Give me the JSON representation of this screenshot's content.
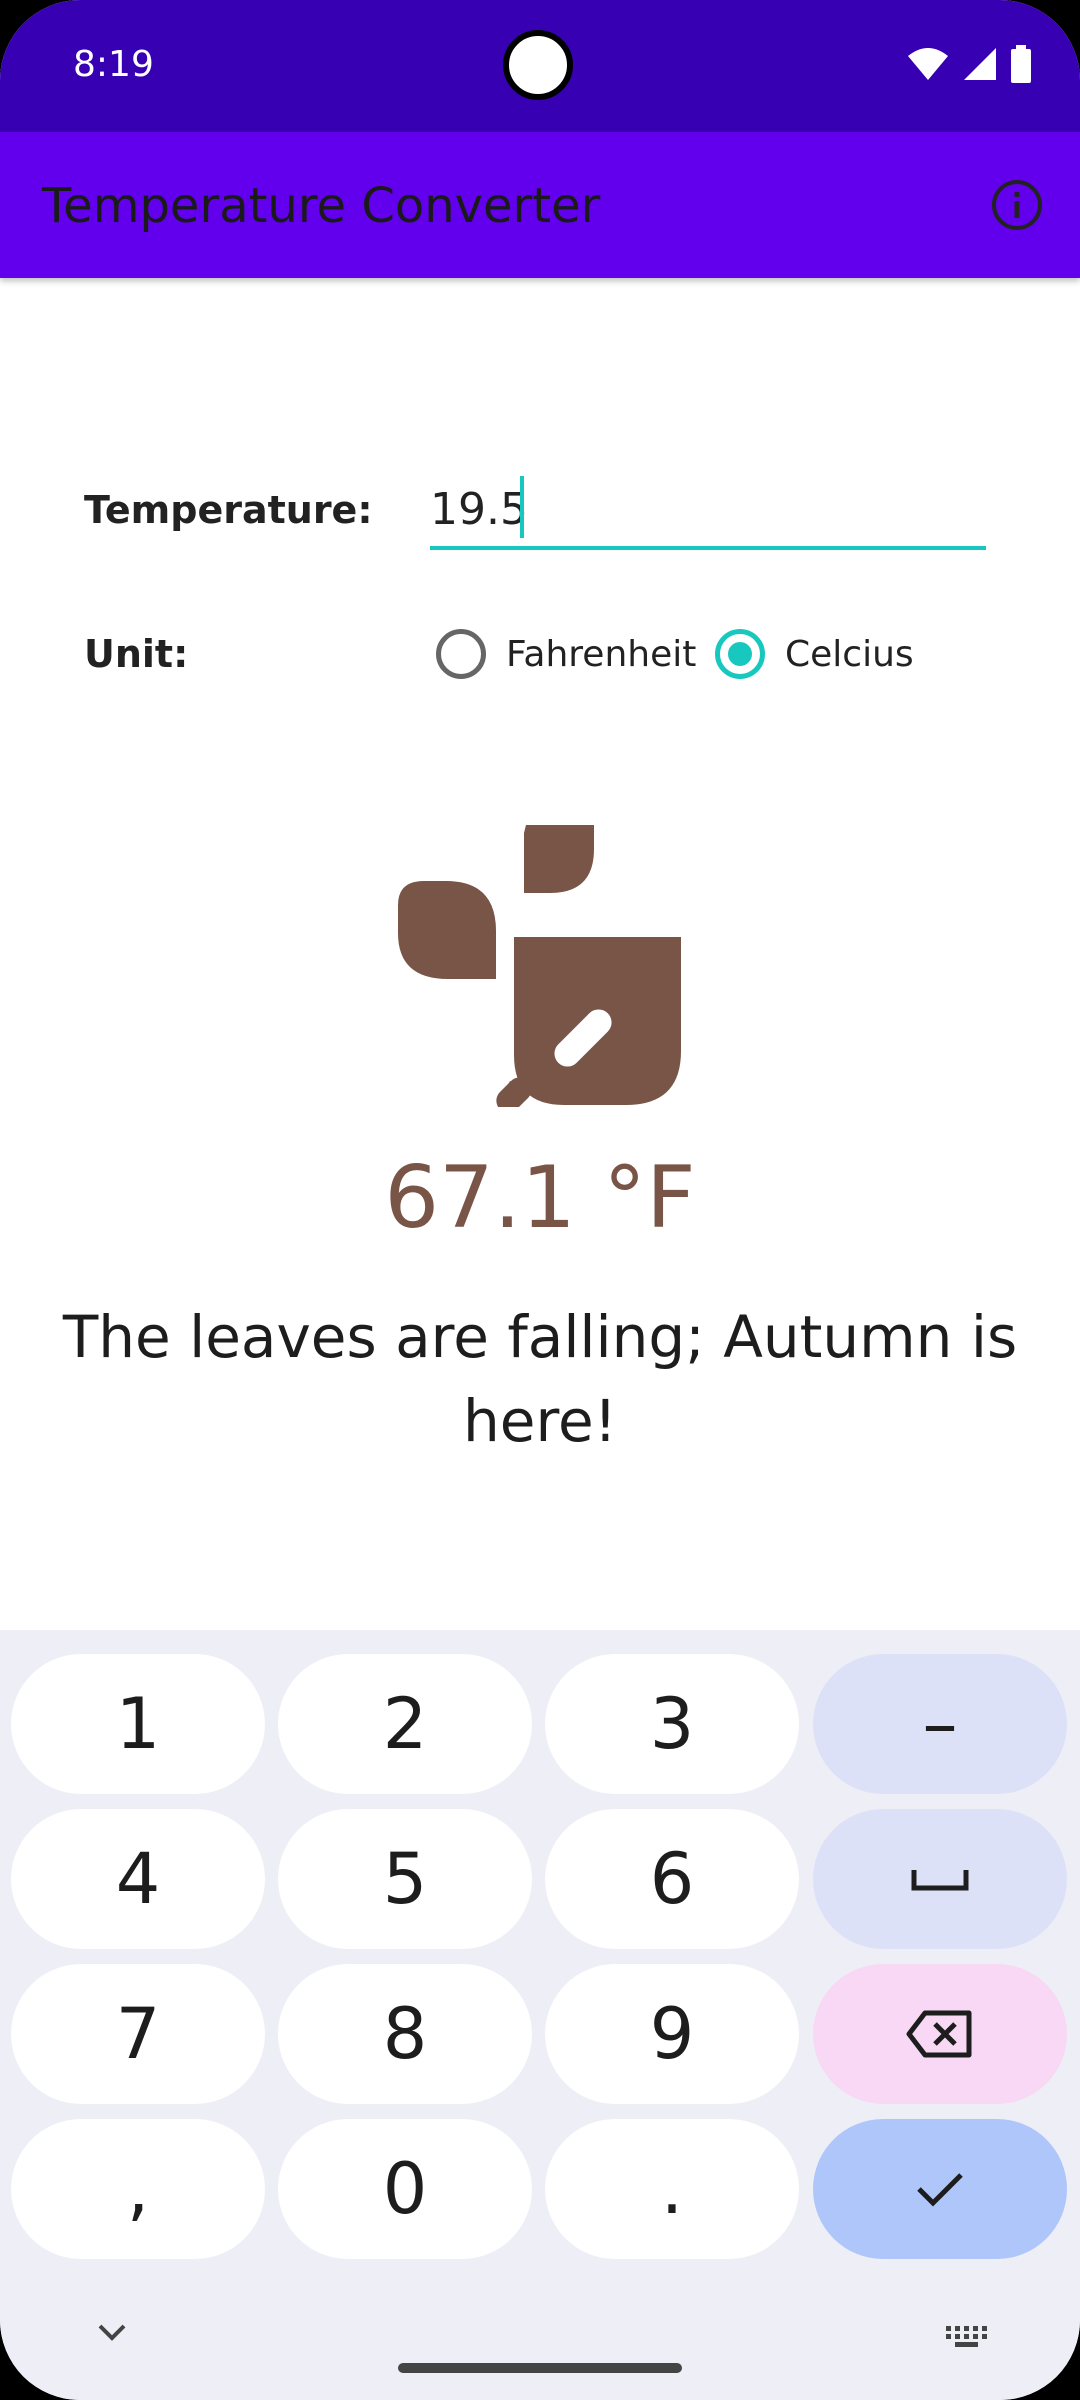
{
  "status_bar": {
    "time": "8:19",
    "icons": [
      "wifi-icon",
      "signal-icon",
      "battery-icon"
    ]
  },
  "app_bar": {
    "title": "Temperature Converter",
    "action_icon": "info-icon"
  },
  "form": {
    "temperature_label": "Temperature:",
    "temperature_value": "19.5",
    "unit_label": "Unit:",
    "units": [
      {
        "label": "Fahrenheit",
        "selected": false
      },
      {
        "label": "Celcius",
        "selected": true
      }
    ]
  },
  "result": {
    "icon": "leaves-icon",
    "value": "67.1 °F",
    "message": "The leaves are falling; Autumn is here!"
  },
  "keyboard": {
    "keys": [
      "1",
      "2",
      "3",
      "–",
      "4",
      "5",
      "6",
      "␣",
      "7",
      "8",
      "9",
      "⌫",
      ",",
      "0",
      ".",
      "✓"
    ]
  },
  "colors": {
    "status_bar": "#3700b3",
    "app_bar": "#6200ee",
    "accent": "#18c8be",
    "result": "#795548"
  }
}
